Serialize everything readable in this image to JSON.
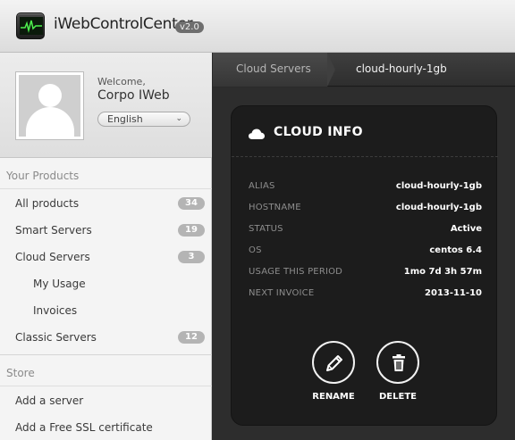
{
  "app": {
    "title": "iWebControlCenter",
    "version": "v2.0"
  },
  "profile": {
    "welcome": "Welcome,",
    "name": "Corpo IWeb",
    "language": "English"
  },
  "sidebar": {
    "products_header": "Your Products",
    "items": [
      {
        "label": "All products",
        "count": "34"
      },
      {
        "label": "Smart Servers",
        "count": "19"
      },
      {
        "label": "Cloud Servers",
        "count": "3"
      },
      {
        "label": "My Usage"
      },
      {
        "label": "Invoices"
      },
      {
        "label": "Classic Servers",
        "count": "12"
      }
    ],
    "store_header": "Store",
    "store_items": [
      {
        "label": "Add a server"
      },
      {
        "label": "Add a Free SSL certificate"
      }
    ]
  },
  "breadcrumb": {
    "parent": "Cloud Servers",
    "current": "cloud-hourly-1gb"
  },
  "card": {
    "title": "CLOUD INFO",
    "rows": [
      {
        "key": "ALIAS",
        "value": "cloud-hourly-1gb"
      },
      {
        "key": "HOSTNAME",
        "value": "cloud-hourly-1gb"
      },
      {
        "key": "STATUS",
        "value": "Active"
      },
      {
        "key": "OS",
        "value": "centos 6.4"
      },
      {
        "key": "USAGE THIS PERIOD",
        "value": "1mo 7d 3h 57m"
      },
      {
        "key": "NEXT INVOICE",
        "value": "2013-11-10"
      }
    ],
    "actions": {
      "rename": "RENAME",
      "delete": "DELETE"
    }
  },
  "icons": {
    "app": "activity-monitor-icon",
    "cloud": "cloud-icon",
    "rename": "pencil-icon",
    "delete": "trash-icon",
    "dropdown": "chevron-down-icon"
  }
}
